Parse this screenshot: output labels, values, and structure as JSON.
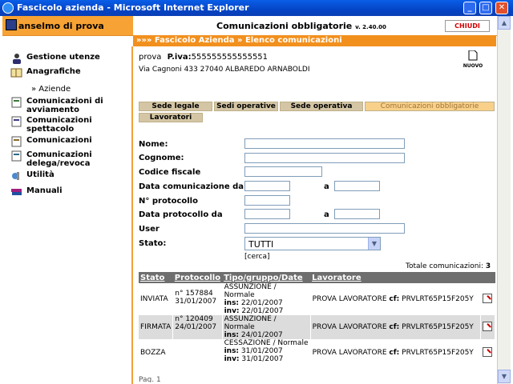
{
  "window": {
    "title": "Fascicolo azienda - Microsoft Internet Explorer",
    "btn_min": "_",
    "btn_max": "□",
    "btn_close": "✕"
  },
  "header": {
    "user": "anselmo di prova",
    "app_title": "Comunicazioni obbligatorie",
    "version": "v. 2.40.00",
    "close_label": "CHIUDI"
  },
  "breadcrumb": "»»» Fascicolo Azienda » Elenco comunicazioni",
  "sidebar": {
    "items": [
      {
        "label": "Gestione utenze",
        "icon": "users-icon"
      },
      {
        "label": "Anagrafiche",
        "icon": "book-icon"
      },
      {
        "label": "» Aziende",
        "icon": ""
      },
      {
        "label": "Comunicazioni di avviamento",
        "icon": "document-icon"
      },
      {
        "label": "Comunicazioni spettacolo",
        "icon": "document-icon"
      },
      {
        "label": "Comunicazioni",
        "icon": "document-icon"
      },
      {
        "label": "Comunicazioni delega/revoca",
        "icon": "document-icon"
      },
      {
        "label": "Utilità",
        "icon": "tools-icon"
      },
      {
        "label": "Manuali",
        "icon": "books-icon"
      }
    ]
  },
  "company": {
    "name": "prova",
    "piva_label": "P.iva:",
    "piva_value": "555555555555551",
    "address": "Via Cagnoni 433 27040 ALBAREDO ARNABOLDI",
    "new_label": "NUOVO"
  },
  "tabs": [
    "Sede legale",
    "Sedi operative",
    "Sede operativa",
    "Comunicazioni obbligatorie",
    "Lavoratori"
  ],
  "form": {
    "nome": "Nome:",
    "cognome": "Cognome:",
    "codice_fiscale": "Codice fiscale",
    "data_com": "Data comunicazione da",
    "a1": "a",
    "protocollo": "N° protocollo",
    "data_prot": "Data protocollo da",
    "a2": "a",
    "user": "User",
    "stato": "Stato:",
    "stato_value": "TUTTI",
    "cerca": "[cerca]"
  },
  "totale": {
    "label": "Totale comunicazioni:",
    "value": "3"
  },
  "table": {
    "headers": [
      "Stato",
      "Protocollo",
      "Tipo/gruppo/Date",
      "Lavoratore"
    ],
    "rows": [
      {
        "stato": "INVIATA",
        "prot_n": "n° 157884",
        "prot_date": "31/01/2007",
        "tipo": "ASSUNZIONE / Normale",
        "ins_label": "ins:",
        "ins": "22/01/2007",
        "inv_label": "inv:",
        "inv": "22/01/2007",
        "lav": "PROVA LAVORATORE",
        "cf_label": "cf:",
        "cf": "PRVLRT65P15F205Y"
      },
      {
        "stato": "FIRMATA",
        "prot_n": "n° 120409",
        "prot_date": "24/01/2007",
        "tipo": "ASSUNZIONE / Normale",
        "ins_label": "ins:",
        "ins": "24/01/2007",
        "inv_label": "",
        "inv": "",
        "lav": "PROVA LAVORATORE",
        "cf_label": "cf:",
        "cf": "PRVLRT65P15F205Y"
      },
      {
        "stato": "BOZZA",
        "prot_n": "",
        "prot_date": "",
        "tipo": "CESSAZIONE / Normale",
        "ins_label": "ins:",
        "ins": "31/01/2007",
        "inv_label": "inv:",
        "inv": "31/01/2007",
        "lav": "PROVA LAVORATORE",
        "cf_label": "cf:",
        "cf": "PRVLRT65P15F205Y"
      }
    ]
  },
  "footer": {
    "page": "Pag. 1"
  }
}
